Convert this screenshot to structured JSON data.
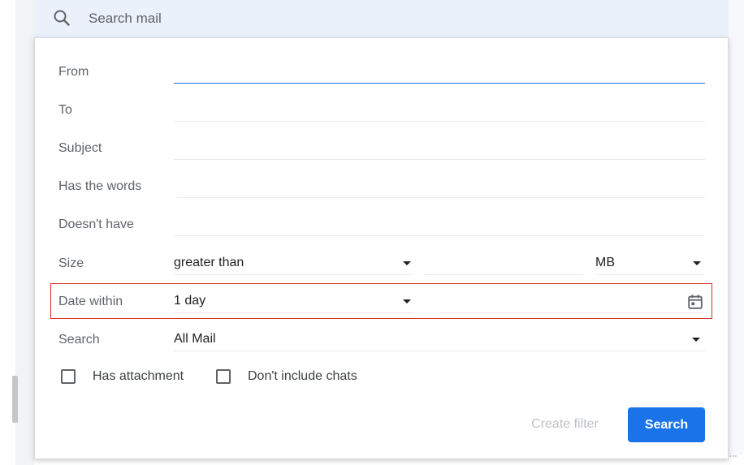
{
  "search": {
    "placeholder": "Search mail"
  },
  "dialog": {
    "rows": {
      "from": {
        "label": "From",
        "value": ""
      },
      "to": {
        "label": "To",
        "value": ""
      },
      "subject": {
        "label": "Subject",
        "value": ""
      },
      "has_words": {
        "label": "Has the words",
        "value": ""
      },
      "doesnt_have": {
        "label": "Doesn't have",
        "value": ""
      },
      "size": {
        "label": "Size",
        "comparator": "greater than",
        "unit": "MB",
        "value": ""
      },
      "date_within": {
        "label": "Date within",
        "value": "1 day",
        "date": ""
      },
      "search_in": {
        "label": "Search",
        "value": "All Mail"
      }
    },
    "checkboxes": [
      {
        "label": "Has attachment",
        "checked": false
      },
      {
        "label": "Don't include chats",
        "checked": false
      }
    ],
    "buttons": {
      "create_filter": "Create filter",
      "search": "Search"
    }
  },
  "colors": {
    "accent": "#1a73e8",
    "highlight_border": "#d93025",
    "label_text": "#5f6368",
    "disabled_text": "#bdc1c6"
  }
}
